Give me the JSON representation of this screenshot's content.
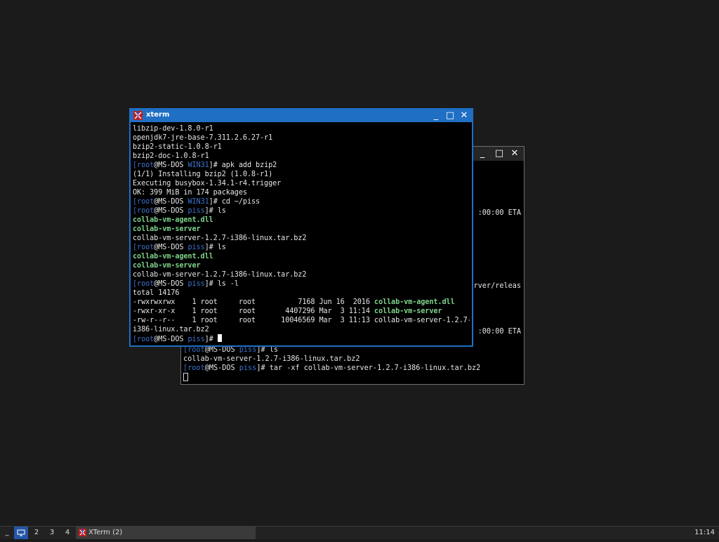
{
  "background_window": {
    "fragments": [
      ":00:00 ETA",
      "rver/releas",
      ":00:00 ETA"
    ],
    "visible_lines": [
      {
        "user": "root",
        "host": "MS-DOS",
        "dir": "piss",
        "cmd": "ls"
      },
      {
        "text": "collab-vm-server-1.2.7-i386-linux.tar.bz2"
      },
      {
        "user": "root",
        "host": "MS-DOS",
        "dir": "piss",
        "cmd": "tar -xf collab-vm-server-1.2.7-i386-linux.tar.bz2"
      }
    ]
  },
  "foreground_window": {
    "title": "xterm",
    "buttons": {
      "minimize": "_",
      "maximize": "□",
      "close": "✕"
    },
    "lines": [
      {
        "text": "libzip-dev-1.8.0-r1"
      },
      {
        "text": "openjdk7-jre-base-7.311.2.6.27-r1"
      },
      {
        "text": "bzip2-static-1.0.8-r1"
      },
      {
        "text": "bzip2-doc-1.0.8-r1"
      },
      {
        "user": "root",
        "host": "MS-DOS",
        "dir": "WIN31",
        "cmd": "apk add bzip2"
      },
      {
        "text": "(1/1) Installing bzip2 (1.0.8-r1)"
      },
      {
        "text": "Executing busybox-1.34.1-r4.trigger"
      },
      {
        "text": "OK: 399 MiB in 174 packages"
      },
      {
        "user": "root",
        "host": "MS-DOS",
        "dir": "WIN31",
        "cmd": "cd ~/piss"
      },
      {
        "user": "root",
        "host": "MS-DOS",
        "dir": "piss",
        "cmd": "ls"
      },
      {
        "hl": "collab-vm-agent.dll"
      },
      {
        "hl": "collab-vm-server"
      },
      {
        "text": "collab-vm-server-1.2.7-i386-linux.tar.bz2"
      },
      {
        "user": "root",
        "host": "MS-DOS",
        "dir": "piss",
        "cmd": "ls"
      },
      {
        "hl": "collab-vm-agent.dll"
      },
      {
        "hl": "collab-vm-server"
      },
      {
        "text": "collab-vm-server-1.2.7-i386-linux.tar.bz2"
      },
      {
        "user": "root",
        "host": "MS-DOS",
        "dir": "piss",
        "cmd": "ls -l"
      },
      {
        "text": "total 14176"
      },
      {
        "text": "-rwxrwxrwx    1 root     root          7168 Jun 16  2016 ",
        "hl": "collab-vm-agent.dll"
      },
      {
        "text": "-rwxr-xr-x    1 root     root       4407296 Mar  3 11:14 ",
        "hl": "collab-vm-server"
      },
      {
        "text": "-rw-r--r--    1 root     root      10046569 Mar  3 11:13 collab-vm-server-1.2.7-"
      },
      {
        "text": "i386-linux.tar.bz2"
      },
      {
        "user": "root",
        "host": "MS-DOS",
        "dir": "piss",
        "cmd": "",
        "cursor": true
      }
    ]
  },
  "taskbar": {
    "workspaces": [
      "1",
      "2",
      "3",
      "4"
    ],
    "active_workspace": "1",
    "task_label": "XTerm (2)",
    "clock": "11:14"
  },
  "colors": {
    "prompt": "#3c72c9",
    "executable": "#7fd38b",
    "titlebar_active": "#1f6fc4"
  }
}
